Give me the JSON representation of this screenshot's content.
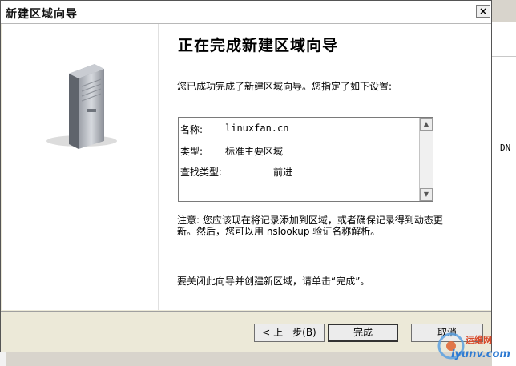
{
  "window": {
    "title": "新建区域向导",
    "close_glyph": "×"
  },
  "wizard": {
    "heading": "正在完成新建区域向导",
    "intro": "您已成功完成了新建区域向导。您指定了如下设置:",
    "settings": [
      {
        "key": "名称:",
        "value": "linuxfan.cn"
      },
      {
        "key": "类型:",
        "value": "标准主要区域"
      },
      {
        "key": "查找类型:",
        "value": "前进"
      }
    ],
    "note": "注意: 您应该现在将记录添加到区域，或者确保记录得到动态更新。然后，您可以用 nslookup 验证名称解析。",
    "closing": "要关闭此向导并创建新区域，请单击“完成”。"
  },
  "buttons": {
    "back": "< 上一步(B)",
    "finish": "完成",
    "cancel": "取消"
  },
  "background": {
    "right_fragment": "DN"
  },
  "watermark": {
    "text_cn": "运维网",
    "text_url": "iyunv.com"
  }
}
